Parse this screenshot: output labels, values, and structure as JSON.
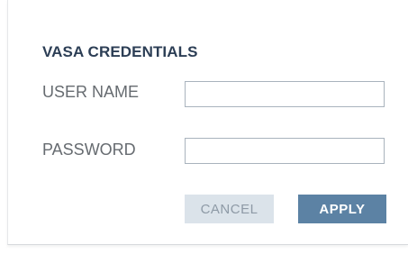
{
  "dialog": {
    "title": "VASA CREDENTIALS",
    "fields": {
      "username": {
        "label": "USER NAME",
        "value": "",
        "placeholder": ""
      },
      "password": {
        "label": "PASSWORD",
        "value": "",
        "placeholder": ""
      }
    },
    "buttons": {
      "cancel": "CANCEL",
      "apply": "APPLY"
    }
  },
  "colors": {
    "title": "#2c3e55",
    "label": "#666b70",
    "input_border": "#a9b3bd",
    "cancel_bg": "#dbe3ea",
    "cancel_text": "#8e9aa6",
    "apply_bg": "#5c82a4",
    "apply_text": "#ffffff"
  }
}
